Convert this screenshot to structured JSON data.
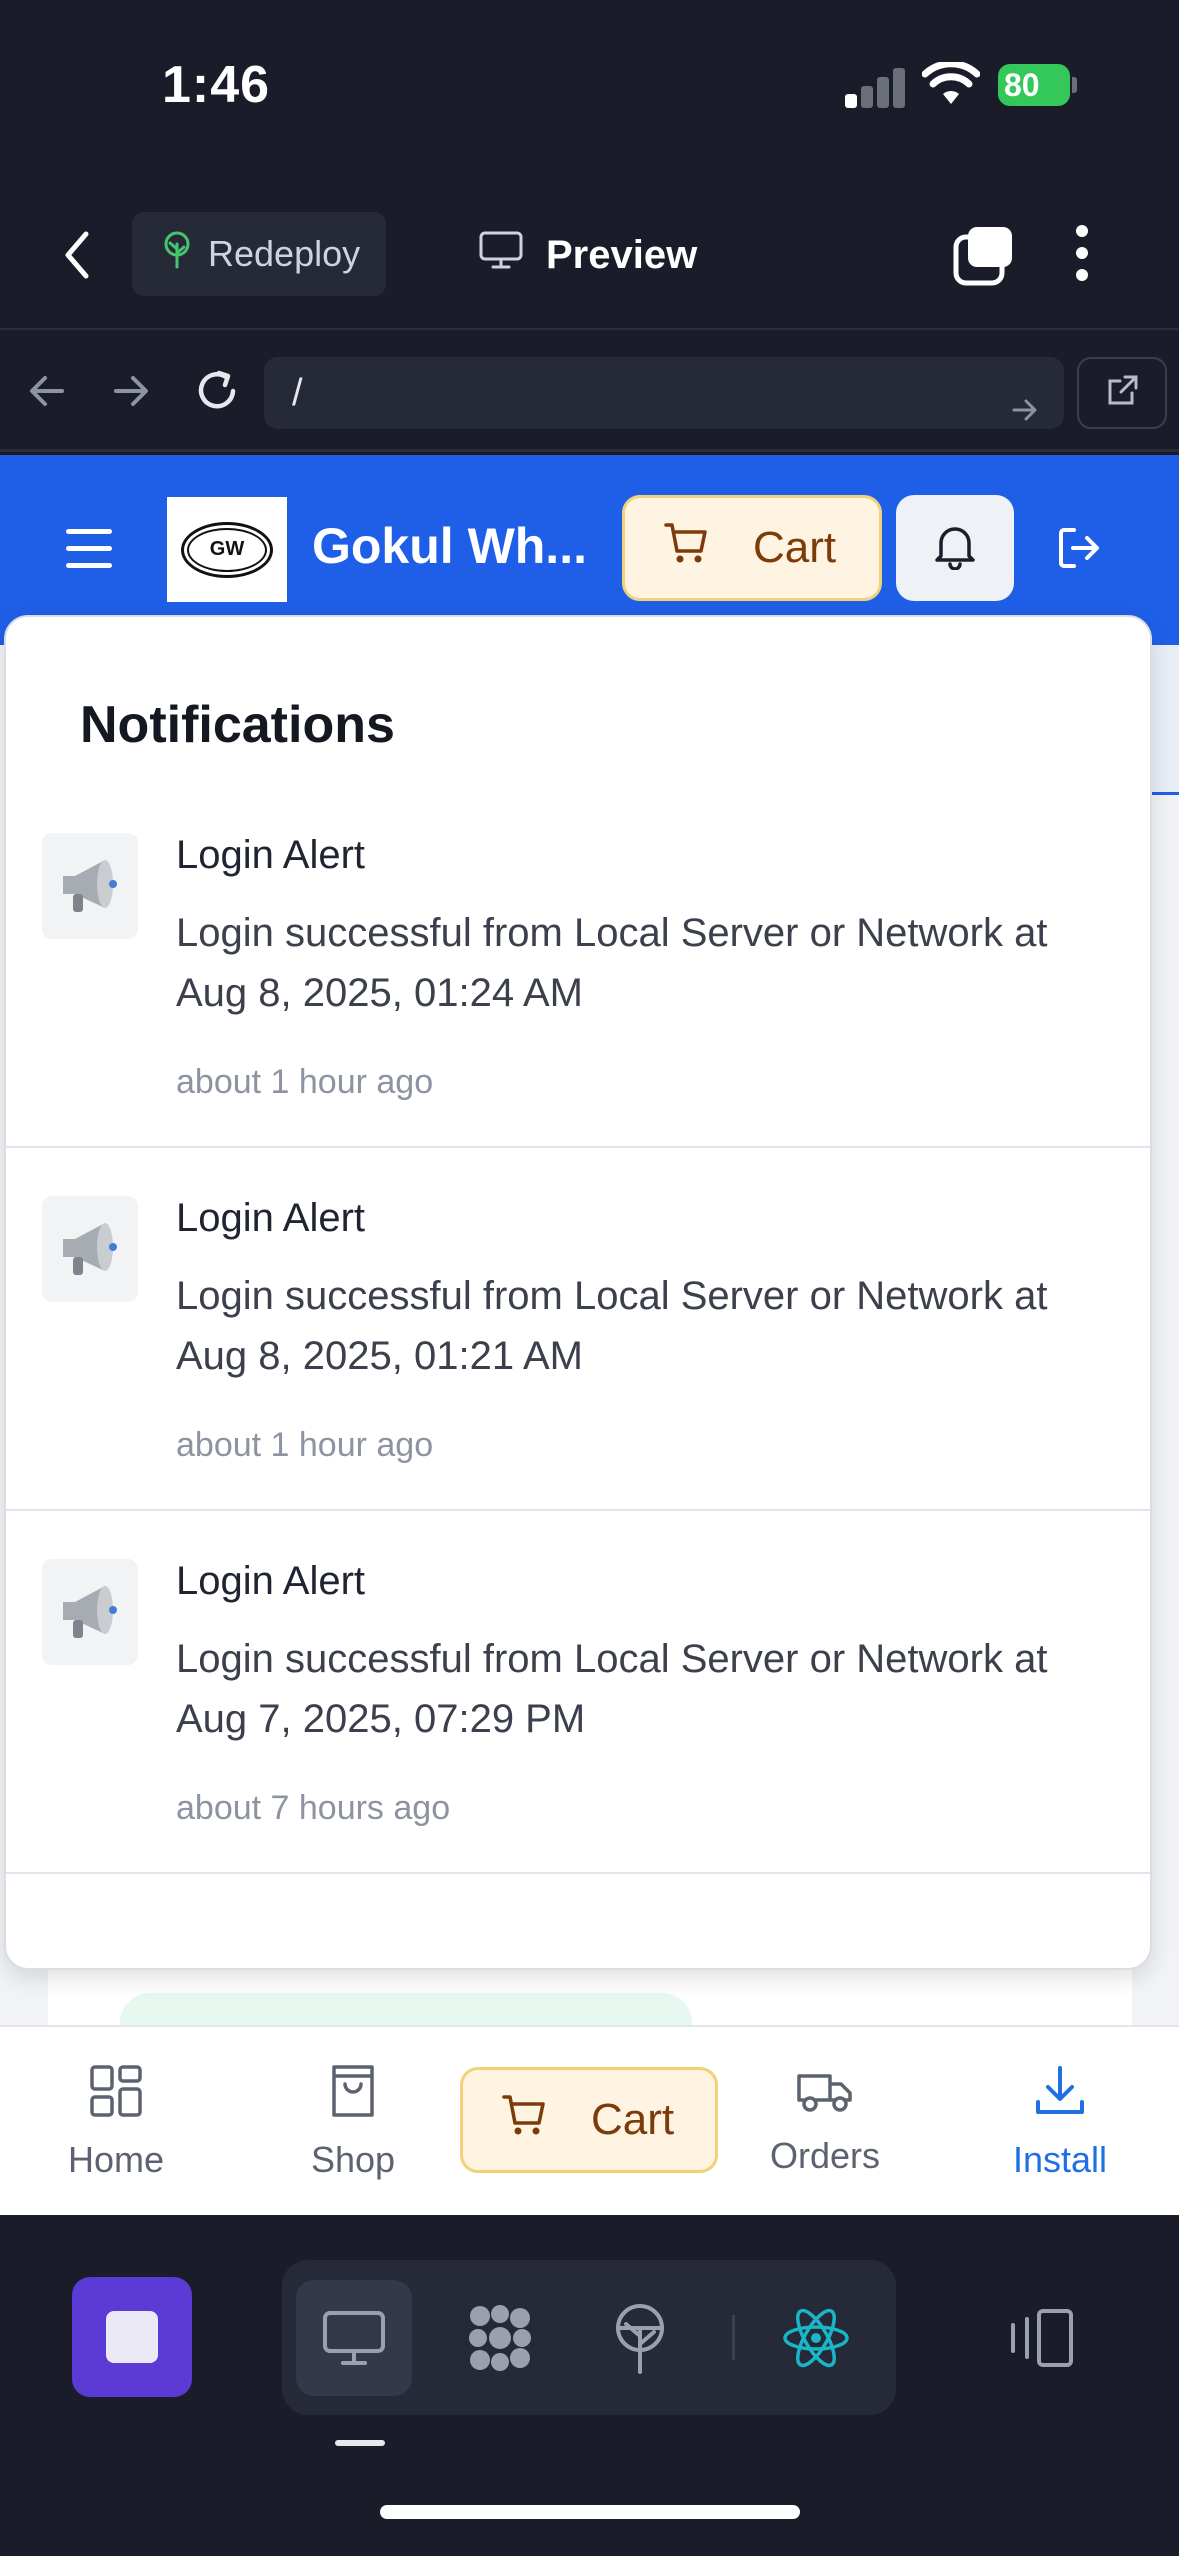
{
  "status_bar": {
    "time": "1:46",
    "battery": "80"
  },
  "app_bar": {
    "redeploy_label": "Redeploy",
    "preview_label": "Preview"
  },
  "url_bar": {
    "url": "/"
  },
  "site": {
    "title": "Gokul Wh...",
    "logo_text": "GW",
    "header_cart_label": "Cart",
    "colors": {
      "header_bg": "#1f5fe8",
      "cart_bg": "#fef4e1",
      "install": "#1f6fe5"
    }
  },
  "notifications": {
    "heading": "Notifications",
    "items": [
      {
        "title": "Login Alert",
        "message": "Login successful from Local Server or Network at Aug 8, 2025, 01:24 AM",
        "time": "about 1 hour ago",
        "icon": "megaphone-icon"
      },
      {
        "title": "Login Alert",
        "message": "Login successful from Local Server or Network at Aug 8, 2025, 01:21 AM",
        "time": "about 1 hour ago",
        "icon": "megaphone-icon"
      },
      {
        "title": "Login Alert",
        "message": "Login successful from Local Server or Network at Aug 7, 2025, 07:29 PM",
        "time": "about 7 hours ago",
        "icon": "megaphone-icon"
      }
    ]
  },
  "bottom_nav": {
    "home": "Home",
    "shop": "Shop",
    "cart": "Cart",
    "orders": "Orders",
    "install": "Install"
  }
}
